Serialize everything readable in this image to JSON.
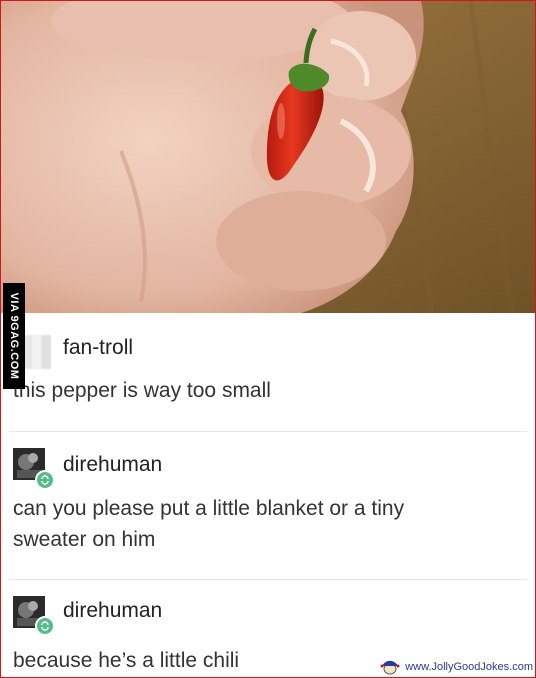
{
  "watermark": "VIA 9GAG.COM",
  "posts": [
    {
      "username": "fan-troll",
      "text": "this pepper is way too small"
    },
    {
      "username": "direhuman",
      "text_line1": "can you please put a little blanket or a tiny",
      "text_line2": "sweater on him"
    },
    {
      "username": "direhuman",
      "text": "because he’s a little chili"
    }
  ],
  "footer": {
    "site": "www.JollyGoodJokes.com"
  },
  "colors": {
    "border": "#d01818",
    "reblog": "#56bc8a",
    "pepper": "#d72a1a"
  }
}
